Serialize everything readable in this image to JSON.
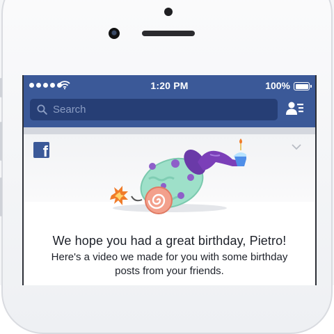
{
  "status_bar": {
    "time": "1:20 PM",
    "battery": "100%"
  },
  "search": {
    "placeholder": "Search"
  },
  "card": {
    "title": "We hope you had a great birthday, Pietro!",
    "subtitle": "Here's a video we made for you with some birthday posts from your friends."
  },
  "colors": {
    "brand": "#3b5998",
    "search_bg": "#263e75"
  },
  "icons": [
    "signal-dots-icon",
    "wifi-icon",
    "battery-icon",
    "search-icon",
    "friend-requests-icon",
    "facebook-logo-icon",
    "chevron-down-icon"
  ]
}
